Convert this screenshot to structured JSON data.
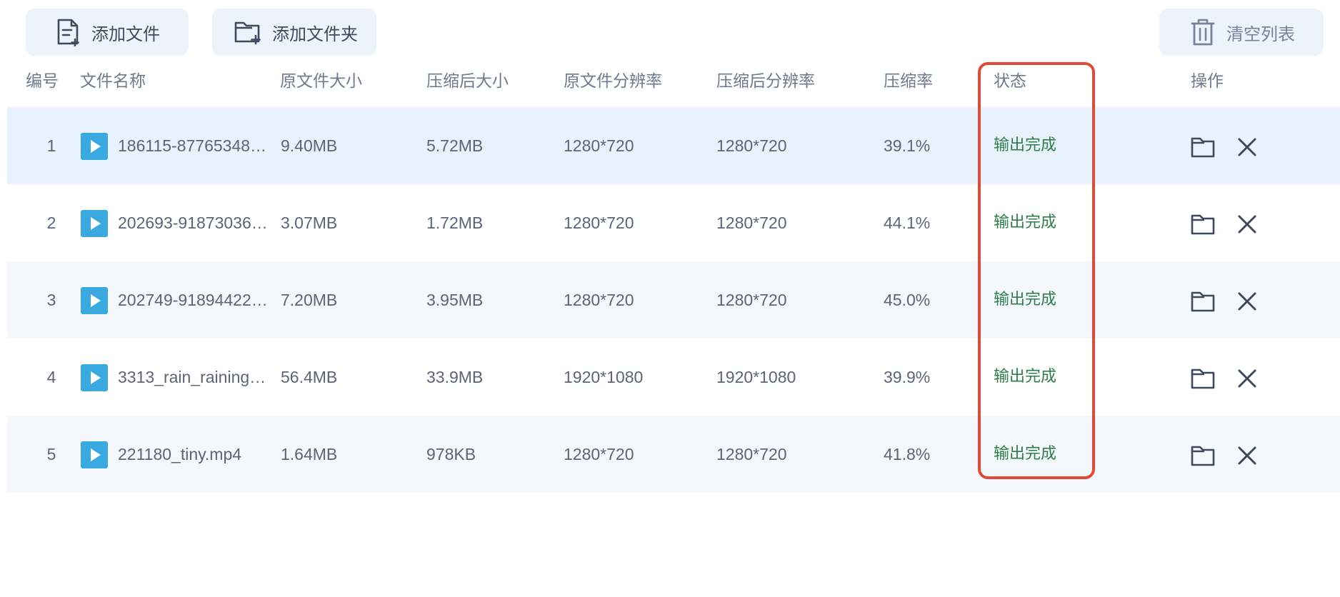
{
  "toolbar": {
    "add_file_label": "添加文件",
    "add_folder_label": "添加文件夹",
    "clear_list_label": "清空列表"
  },
  "table": {
    "headers": {
      "index": "编号",
      "filename": "文件名称",
      "orig_size": "原文件大小",
      "comp_size": "压缩后大小",
      "orig_res": "原文件分辨率",
      "comp_res": "压缩后分辨率",
      "ratio": "压缩率",
      "status": "状态",
      "actions": "操作"
    },
    "rows": [
      {
        "index": "1",
        "filename": "186115-87765348…",
        "orig_size": "9.40MB",
        "comp_size": "5.72MB",
        "orig_res": "1280*720",
        "comp_res": "1280*720",
        "ratio": "39.1%",
        "status": "输出完成"
      },
      {
        "index": "2",
        "filename": "202693-91873036…",
        "orig_size": "3.07MB",
        "comp_size": "1.72MB",
        "orig_res": "1280*720",
        "comp_res": "1280*720",
        "ratio": "44.1%",
        "status": "输出完成"
      },
      {
        "index": "3",
        "filename": "202749-91894422…",
        "orig_size": "7.20MB",
        "comp_size": "3.95MB",
        "orig_res": "1280*720",
        "comp_res": "1280*720",
        "ratio": "45.0%",
        "status": "输出完成"
      },
      {
        "index": "4",
        "filename": "3313_rain_raining…",
        "orig_size": "56.4MB",
        "comp_size": "33.9MB",
        "orig_res": "1920*1080",
        "comp_res": "1920*1080",
        "ratio": "39.9%",
        "status": "输出完成"
      },
      {
        "index": "5",
        "filename": "221180_tiny.mp4",
        "orig_size": "1.64MB",
        "comp_size": "978KB",
        "orig_res": "1280*720",
        "comp_res": "1280*720",
        "ratio": "41.8%",
        "status": "输出完成"
      }
    ]
  },
  "colors": {
    "accent_play": "#3aa9e0",
    "status_done": "#2f7d4a",
    "highlight": "#e04a36",
    "button_bg": "#edf3fb"
  },
  "icons": {
    "add_file": "file-plus-icon",
    "add_folder": "folder-plus-icon",
    "clear": "trash-icon",
    "play": "play-icon",
    "open_folder": "folder-icon",
    "remove": "close-icon"
  }
}
